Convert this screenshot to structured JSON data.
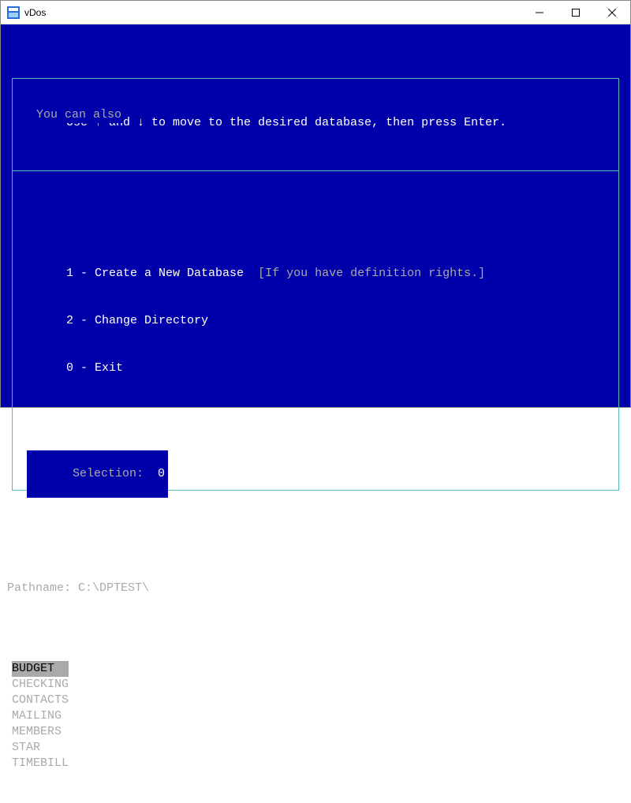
{
  "window": {
    "title": "vDos",
    "icons": {
      "app": "vdos-icon",
      "min": "minimize-icon",
      "max": "maximize-icon",
      "close": "close-icon"
    }
  },
  "screen": {
    "instruction": "Use ↑ and ↓ to move to the desired database, then press Enter.",
    "legend": "You can also",
    "options": [
      {
        "key": "1",
        "label": "Create a New Database",
        "hint": "[If you have definition rights.]"
      },
      {
        "key": "2",
        "label": "Change Directory",
        "hint": ""
      },
      {
        "key": "0",
        "label": "Exit",
        "hint": ""
      }
    ],
    "selection_label": "Selection:",
    "selection_value": "0",
    "path_label": "Pathname:",
    "path_value": "C:\\DPTEST\\",
    "databases": [
      "BUDGET",
      "CHECKING",
      "CONTACTS",
      "MAILING",
      "MEMBERS",
      "STAR",
      "TIMEBILL"
    ],
    "selected_index": 0
  },
  "colors": {
    "bg": "#0000aa",
    "fg_dim": "#aaaaaa",
    "fg_bright": "#ffffff",
    "border": "#55bbbb"
  }
}
